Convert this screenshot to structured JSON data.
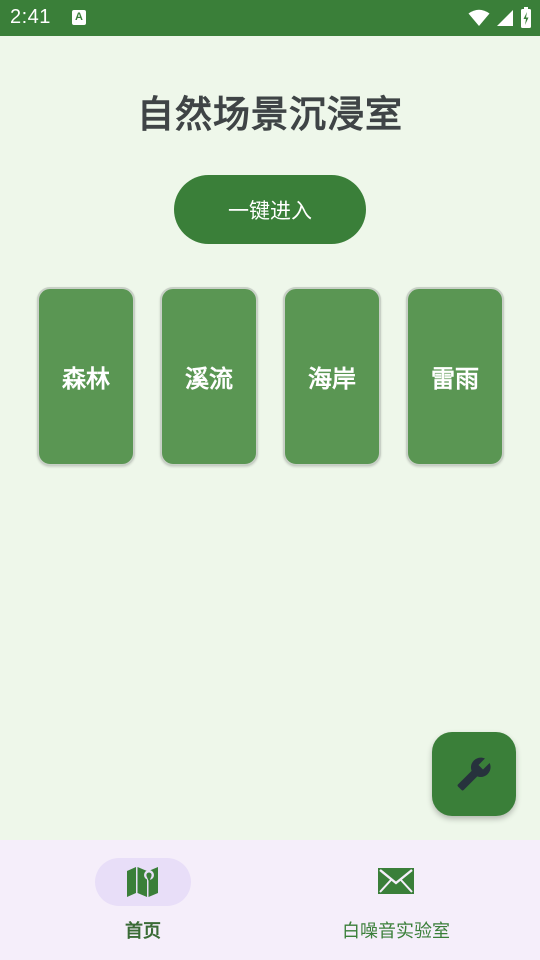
{
  "status_bar": {
    "time": "2:41",
    "notification_glyph": "A",
    "icons": [
      "wifi-icon",
      "signal-icon",
      "battery-icon"
    ]
  },
  "page": {
    "title": "自然场景沉浸室",
    "enter_button_label": "一键进入"
  },
  "scenes": [
    {
      "label": "森林"
    },
    {
      "label": "溪流"
    },
    {
      "label": "海岸"
    },
    {
      "label": "雷雨"
    }
  ],
  "fab": {
    "icon": "wrench-icon"
  },
  "bottom_nav": {
    "items": [
      {
        "label": "首页",
        "icon": "map-icon",
        "selected": true
      },
      {
        "label": "白噪音实验室",
        "icon": "mail-icon",
        "selected": false
      }
    ]
  },
  "colors": {
    "primary": "#3a7f39",
    "card": "#5a9653",
    "background": "#eef7ea",
    "nav_background": "#f5eefa",
    "nav_indicator": "#e8def8"
  }
}
